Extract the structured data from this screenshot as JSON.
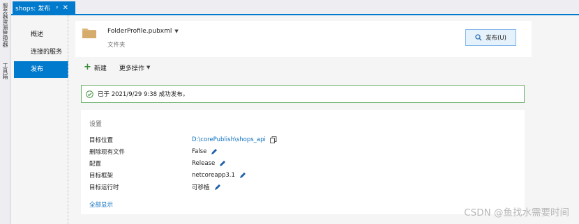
{
  "side_tabs": [
    "服务器资源管理器",
    "工具箱"
  ],
  "tab": {
    "title": "shops: 发布",
    "pin_glyph": "ᵖ",
    "close_glyph": "✕"
  },
  "nav": {
    "items": [
      {
        "label": "概述"
      },
      {
        "label": "连接的服务"
      },
      {
        "label": "发布",
        "active": true
      }
    ]
  },
  "profile": {
    "name": "FolderProfile.pubxml",
    "type": "文件夹",
    "publish_label": "发布(U)"
  },
  "toolbar": {
    "new_label": "新建",
    "more_label": "更多操作"
  },
  "status": {
    "message": "已于 2021/9/29 9:38 成功发布。"
  },
  "settings": {
    "title": "设置",
    "rows": [
      {
        "label": "目标位置",
        "value": "D:\\corePublish\\shops_api"
      },
      {
        "label": "删除现有文件",
        "value": "False"
      },
      {
        "label": "配置",
        "value": "Release"
      },
      {
        "label": "目标框架",
        "value": "netcoreapp3.1"
      },
      {
        "label": "目标运行时",
        "value": "可移植"
      }
    ],
    "show_all": "全部显示"
  },
  "watermark": "CSDN @鱼找水需要时间",
  "colors": {
    "accent": "#007acc",
    "success_border": "#6cb16b",
    "link": "#0e70c0"
  }
}
